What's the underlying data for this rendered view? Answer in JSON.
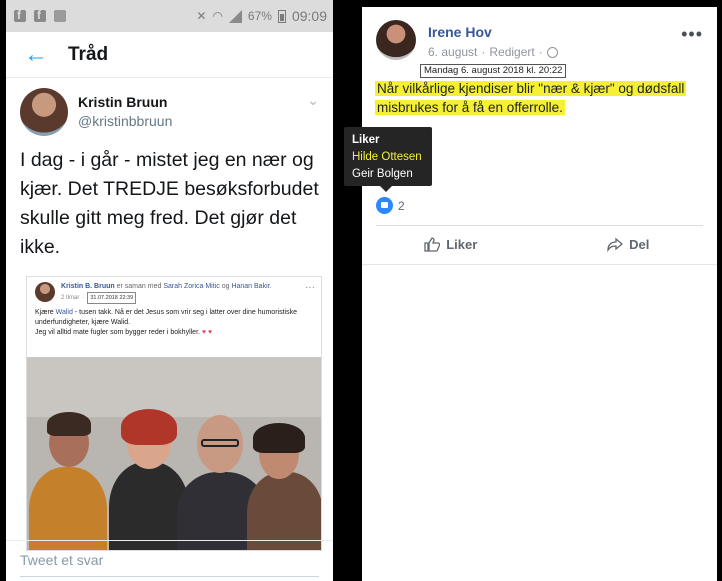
{
  "status_bar": {
    "battery": "67%",
    "time": "09:09"
  },
  "twitter": {
    "header_title": "Tråd",
    "author_name": "Kristin Bruun",
    "author_handle": "@kristinbbruun",
    "tweet_text": "I dag - i går - mistet jeg en nær og kjær. Det TREDJE besøksforbudet skulle gitt meg fred. Det gjør det ikke.",
    "reply_placeholder": "Tweet et svar",
    "embed": {
      "author": "Kristin B. Bruun",
      "with_text": "er saman med",
      "tag1": "Sarah Zorica Mitic",
      "and_text": "og",
      "tag2": "Hanan Bakir.",
      "time": "2 timar",
      "stamp": "31.07.2018 22:39",
      "line1_pre": "Kjære",
      "line1_name": "Walid",
      "line1_post": "- tusen takk. Nå er det Jesus som vrir seg i latter over dine humoristiske underfundigheter, kjære Walid.",
      "line2": "Jeg vil alltid mate fugler som bygger reder i bokhyller."
    }
  },
  "facebook": {
    "author_name": "Irene Hov",
    "date": "6. august",
    "edited": "Redigert",
    "timestamp_tooltip": "Mandag 6. august 2018 kl. 20:22",
    "post_line1": "Når vilkårlige kjendiser blir \"nær & kjær\" og dødsfall",
    "post_line2": "misbrukes for å få en offerrolle.",
    "like_count": "2",
    "like_label": "Liker",
    "share_label": "Del",
    "likers_popup": {
      "title": "Liker",
      "names": [
        "Hilde Ottesen",
        "Geir Bolgen"
      ]
    }
  },
  "colors": {
    "twitter_blue": "#1da1f2",
    "fb_link": "#365899",
    "highlight": "#f5f033"
  }
}
